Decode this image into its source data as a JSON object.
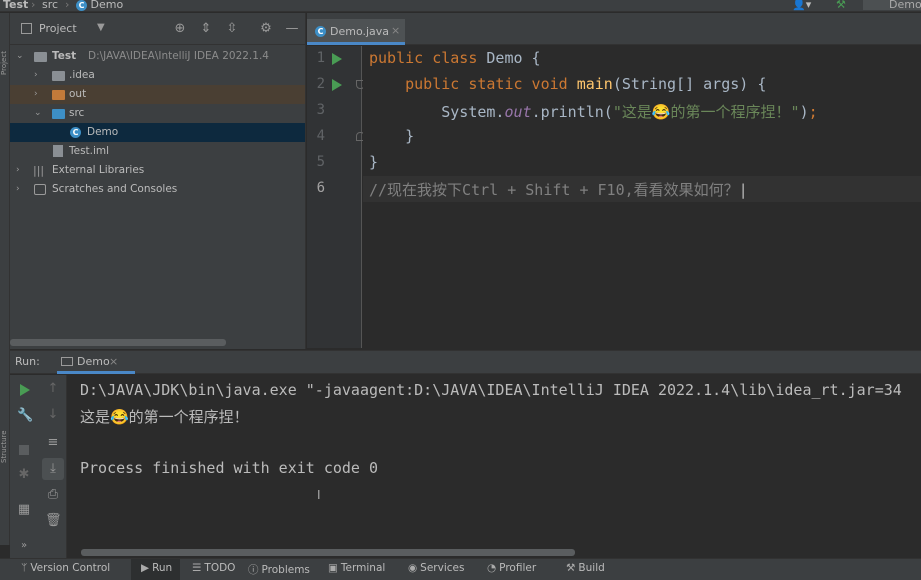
{
  "navbar": {
    "project": "Test",
    "folder": "src",
    "file": "Demo",
    "right_label": "Demo"
  },
  "left_stripe": {
    "label_top": "Project",
    "label_bottom": "Structure"
  },
  "project_panel": {
    "title": "Project",
    "tree": [
      {
        "label": "Test",
        "path": "D:\\JAVA\\IDEA\\IntelliJ IDEA 2022.1.4",
        "depth": 0,
        "expanded": true
      },
      {
        "label": ".idea",
        "depth": 1,
        "expanded": false
      },
      {
        "label": "out",
        "depth": 1,
        "expanded": false
      },
      {
        "label": "src",
        "depth": 1,
        "expanded": true
      },
      {
        "label": "Demo",
        "depth": 2
      },
      {
        "label": "Test.iml",
        "depth": 1
      },
      {
        "label": "External Libraries",
        "depth": 0,
        "expanded": false
      },
      {
        "label": "Scratches and Consoles",
        "depth": 0,
        "expanded": false
      }
    ]
  },
  "editor": {
    "tab_label": "Demo.java",
    "line_numbers": [
      "1",
      "2",
      "3",
      "4",
      "5",
      "6"
    ],
    "lines": {
      "l1_kw": "public class ",
      "l1_rest": "Demo {",
      "l2_indent": "    ",
      "l2_kw": "public static void ",
      "l2_fn": "main",
      "l2_rest": "(String[] args) {",
      "l3_indent": "        ",
      "l3_a": "System.",
      "l3_out": "out",
      "l3_b": ".println(",
      "l3_str": "\"这是😂的第一个程序捏！\"",
      "l3_c": ")",
      "l3_semi": ";",
      "l4": "    }",
      "l5": "}",
      "l6_comment": "//现在我按下Ctrl + Shift + F10,看看效果如何？"
    }
  },
  "run_panel": {
    "label": "Run:",
    "tab_label": "Demo",
    "console": [
      "D:\\JAVA\\JDK\\bin\\java.exe \"-javaagent:D:\\JAVA\\IDEA\\IntelliJ IDEA 2022.1.4\\lib\\idea_rt.jar=34",
      "这是😂的第一个程序捏！",
      "",
      "Process finished with exit code 0"
    ]
  },
  "statusbar": {
    "items": [
      "Version Control",
      "Run",
      "TODO",
      "Problems",
      "Terminal",
      "Services",
      "Profiler",
      "Build"
    ]
  },
  "colors": {
    "accent": "#4a88c7",
    "run_green": "#499c54",
    "keyword": "#cc7832",
    "string": "#6a8759",
    "method": "#ffc66d"
  }
}
